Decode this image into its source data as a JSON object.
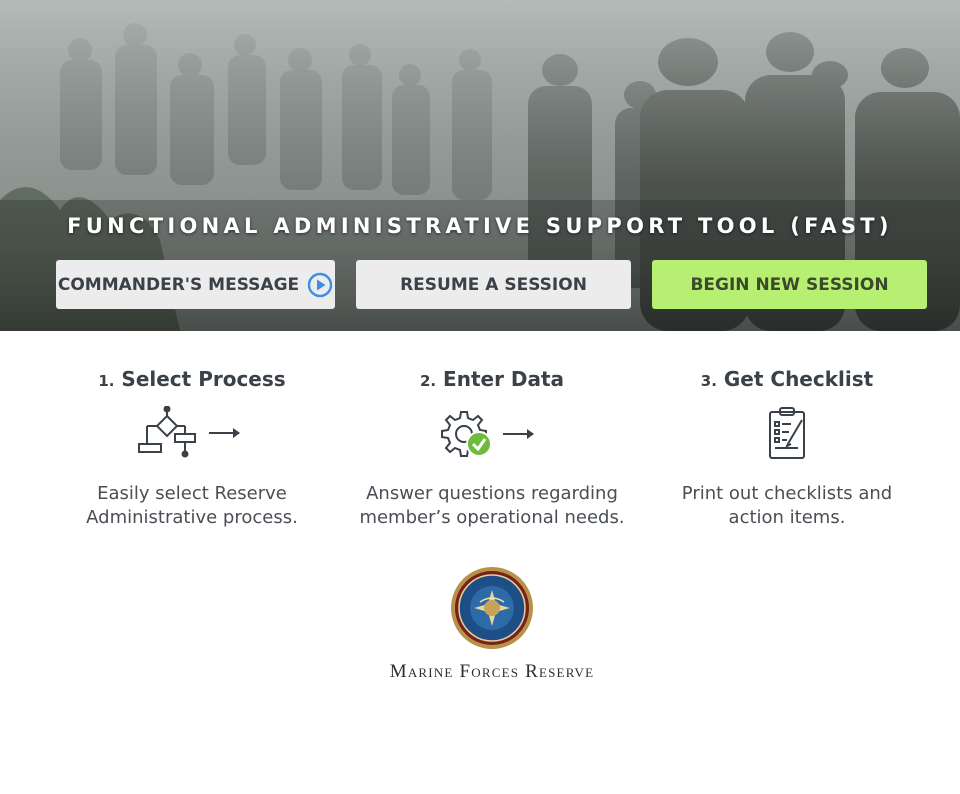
{
  "hero": {
    "title": "FUNCTIONAL ADMINISTRATIVE SUPPORT TOOL (FAST)",
    "buttons": {
      "commander": "COMMANDER'S MESSAGE",
      "resume": "RESUME A SESSION",
      "begin": "BEGIN NEW SESSION"
    },
    "icons": {
      "commander": "play-circle-icon"
    }
  },
  "steps": [
    {
      "num": "1.",
      "title": "Select Process",
      "icon": "flowchart-arrow-icon",
      "desc_line1": "Easily select Reserve",
      "desc_line2": "Administrative process."
    },
    {
      "num": "2.",
      "title": "Enter Data",
      "icon": "gear-check-arrow-icon",
      "desc_line1": "Answer questions regarding",
      "desc_line2": "member’s operational needs."
    },
    {
      "num": "3.",
      "title": "Get Checklist",
      "icon": "clipboard-checklist-icon",
      "desc_line1": "Print out checklists and",
      "desc_line2": "action items."
    }
  ],
  "footer": {
    "org_name": "Marine Forces Reserve",
    "seal_icon": "marine-forces-reserve-seal"
  },
  "colors": {
    "begin_button": "#b7ef72",
    "neutral_button": "#ececec",
    "play_icon": "#3a8ee6",
    "check_badge": "#6dbb3c",
    "text": "#3b4148"
  }
}
